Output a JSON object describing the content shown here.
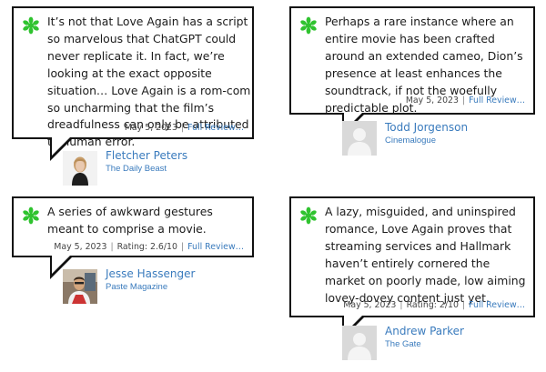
{
  "colors": {
    "splat": "#2fc32f",
    "link": "#3a7bbd",
    "border": "#111111"
  },
  "reviews": [
    {
      "quote": "It’s not that Love Again has a script so marvelous that ChatGPT could never replicate it. In fact, we’re looking at the exact opposite situation… Love Again is a rom-com so uncharming that the film’s dreadfulness can only be attributed to human error.",
      "date": "May 5, 2023",
      "rating": "",
      "link": "Full Review…",
      "critic": "Fletcher Peters",
      "publication": "The Daily Beast",
      "avatar_icon": "photo-avatar-fletcher"
    },
    {
      "quote": "Perhaps a rare instance where an entire movie has been crafted around an extended cameo, Dion’s presence at least enhances the soundtrack, if not the woefully predictable plot.",
      "date": "May 5, 2023",
      "rating": "",
      "link": "Full Review…",
      "critic": "Todd Jorgenson",
      "publication": "Cinemalogue",
      "avatar_icon": "default-avatar"
    },
    {
      "quote": "A series of awkward gestures meant to comprise a movie.",
      "date": "May 5, 2023",
      "rating": "Rating: 2.6/10",
      "link": "Full Review…",
      "critic": "Jesse Hassenger",
      "publication": "Paste Magazine",
      "avatar_icon": "photo-avatar-jesse"
    },
    {
      "quote": "A lazy, misguided, and uninspired romance, Love Again proves that streaming services and Hallmark haven’t entirely cornered the market on poorly made, low aiming lovey-dovey content just yet.",
      "date": "May 5, 2023",
      "rating": "Rating: 2/10",
      "link": "Full Review…",
      "critic": "Andrew Parker",
      "publication": "The Gate",
      "avatar_icon": "default-avatar"
    }
  ]
}
